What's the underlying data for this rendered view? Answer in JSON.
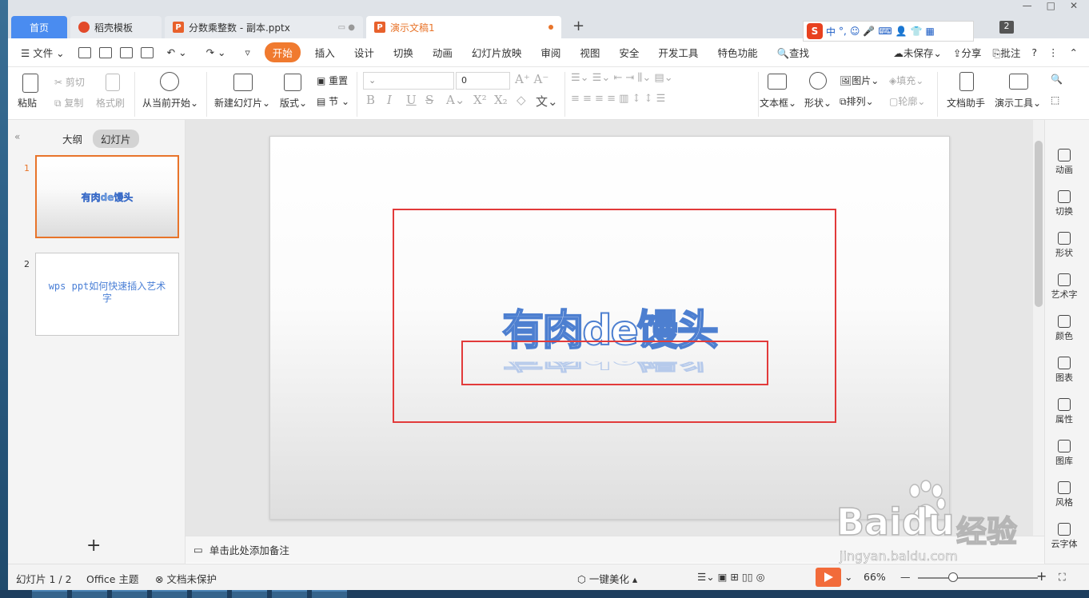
{
  "tabs": {
    "home": "首页",
    "docer": "稻壳模板",
    "pptx": "分数乘整数 - 副本.pptx",
    "demo": "演示文稿1",
    "add": "+"
  },
  "window": {
    "badge": "2"
  },
  "ime": {
    "s": "S",
    "lang": "中",
    "punct": "°,"
  },
  "menu": {
    "file": "文件",
    "start": "开始",
    "insert": "插入",
    "design": "设计",
    "transition": "切换",
    "animation": "动画",
    "slideshow": "幻灯片放映",
    "review": "审阅",
    "view": "视图",
    "security": "安全",
    "devtools": "开发工具",
    "special": "特色功能",
    "search": "查找",
    "unsaved": "未保存",
    "share": "分享",
    "comment": "批注",
    "help": "?"
  },
  "ribbon": {
    "paste": "粘贴",
    "cut": "剪切",
    "copy": "复制",
    "format_painter": "格式刷",
    "from_current": "从当前开始",
    "new_slide": "新建幻灯片",
    "layout": "版式",
    "reset": "重置",
    "section": "节",
    "font_size": "0",
    "textbox": "文本框",
    "shape": "形状",
    "picture": "图片",
    "arrange": "排列",
    "fill": "填充",
    "outline": "轮廓",
    "doc_assistant": "文档助手",
    "presentation_tools": "演示工具"
  },
  "left_panel": {
    "outline_tab": "大纲",
    "slides_tab": "幻灯片",
    "slides": [
      {
        "num": "1",
        "text": "有肉de馒头"
      },
      {
        "num": "2",
        "text": "wps ppt如何快速插入艺术字"
      }
    ],
    "add": "+"
  },
  "slide": {
    "wordart": "有肉de馒头"
  },
  "notes": {
    "placeholder": "单击此处添加备注"
  },
  "right_tools": [
    "动画",
    "切换",
    "形状",
    "艺术字",
    "颜色",
    "图表",
    "属性",
    "图库",
    "风格",
    "云字体"
  ],
  "status": {
    "slide_count": "幻灯片 1 / 2",
    "theme": "Office 主题",
    "protection": "文档未保护",
    "beautify": "一键美化",
    "zoom": "66%",
    "zoom_minus": "—",
    "zoom_plus": "+"
  },
  "watermark": {
    "logo": "Baidu",
    "cn": "经验",
    "url": "jingyan.baidu.com"
  },
  "colors": {
    "accent": "#f07a2f",
    "tab_active": "#4a8cf0",
    "highlight_box": "#e23a3a",
    "wordart_outline": "#4d7fd0"
  }
}
